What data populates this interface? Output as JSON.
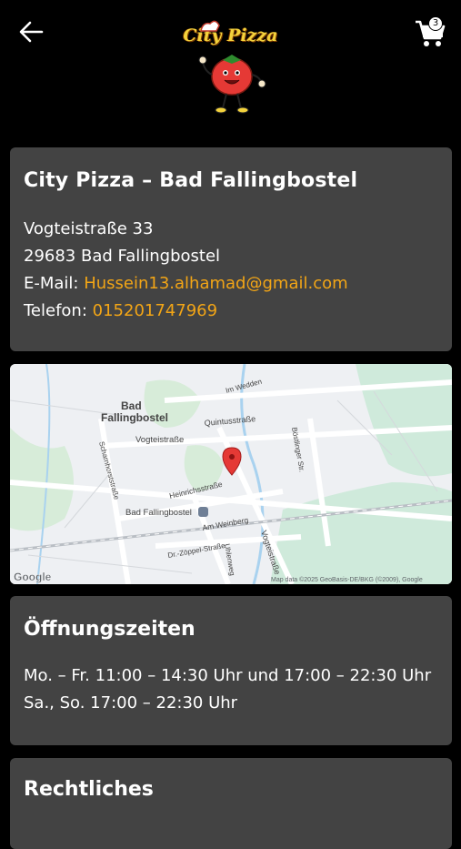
{
  "header": {
    "logo_text": "City Pizza",
    "cart_count": "3",
    "icons": [
      "back-arrow-icon",
      "cart-icon"
    ]
  },
  "info": {
    "title": "City Pizza – Bad Fallingbostel",
    "street": "Vogteistraße 33",
    "city": "29683 Bad Fallingbostel",
    "email_label": "E-Mail: ",
    "email": "Hussein13.alhamad@gmail.com",
    "phone_label": "Telefon: ",
    "phone": "015201747969"
  },
  "map": {
    "labels": {
      "town_line1": "Bad",
      "town_line2": "Fallingbostel",
      "vogteistrasse": "Vogteistraße",
      "quintusstrasse": "Quintusstraße",
      "im_wedden": "Im Wedden",
      "bostlinger": "Böstlinger Str.",
      "scharnhorst": "Scharnhorststraße",
      "heinrichstrasse": "Heinrichsstraße",
      "station": "Bad Fallingbostel",
      "am_weinberg": "Am Weinberg",
      "zoeppel": "Dr.-Zöppel-Straße",
      "uhlenweg": "Uhlenweg",
      "vogteistrasse2": "Vogteistraße"
    },
    "google": "Google",
    "attribution": "Map data ©2025 GeoBasis-DE/BKG (©2009), Google",
    "pin_color": "#e53935"
  },
  "hours": {
    "title": "Öffnungszeiten",
    "line1": "Mo. – Fr. 11:00 – 14:30 Uhr und 17:00 – 22:30 Uhr",
    "line2": "Sa., So. 17:00 – 22:30 Uhr"
  },
  "legal": {
    "title": "Rechtliches"
  },
  "colors": {
    "background": "#000000",
    "card": "#434343",
    "accent": "#f2a516"
  }
}
